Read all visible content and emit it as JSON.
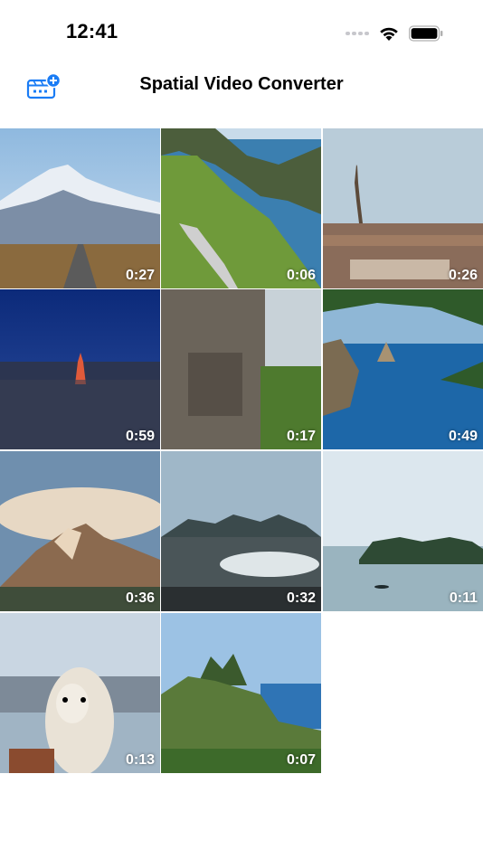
{
  "status": {
    "time": "12:41"
  },
  "nav": {
    "title": "Spatial Video Converter",
    "add_icon": "video-add-icon",
    "accent": "#1a7cf5"
  },
  "videos": [
    {
      "duration": "0:27",
      "subject": "snowy mountain and road"
    },
    {
      "duration": "0:06",
      "subject": "coastal cliff walkway"
    },
    {
      "duration": "0:26",
      "subject": "paris eiffel tower"
    },
    {
      "duration": "0:59",
      "subject": "tokyo tower at night"
    },
    {
      "duration": "0:17",
      "subject": "angkor stone face"
    },
    {
      "duration": "0:49",
      "subject": "capri sea stacks and palm"
    },
    {
      "duration": "0:36",
      "subject": "torres del paine peaks"
    },
    {
      "duration": "0:32",
      "subject": "black sand beach mountains"
    },
    {
      "duration": "0:11",
      "subject": "ha long bay islands"
    },
    {
      "duration": "0:13",
      "subject": "alpaca by a lake"
    },
    {
      "duration": "0:07",
      "subject": "pitons and coastal town"
    }
  ]
}
